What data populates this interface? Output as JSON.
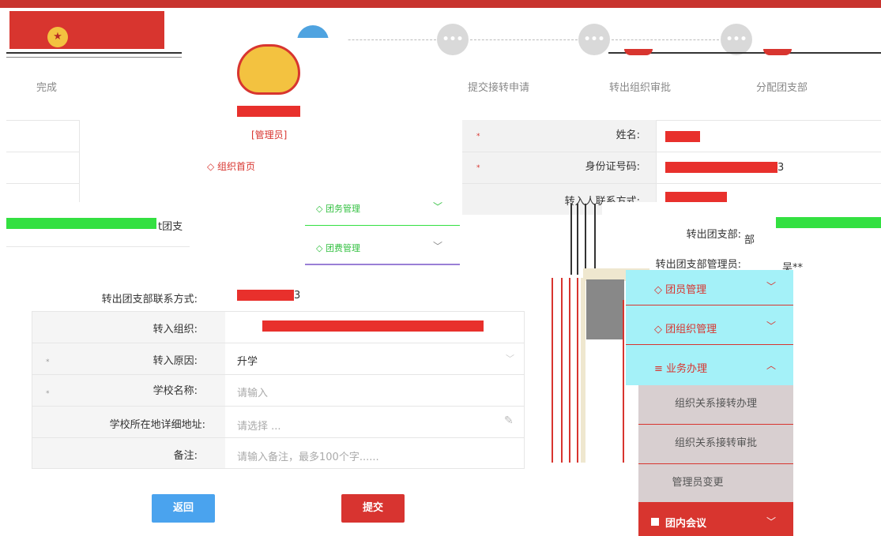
{
  "header": {
    "logo_glyph": "★"
  },
  "steps": [
    {
      "label": "完成",
      "icon": "more-dots-icon"
    },
    {
      "label": "",
      "icon": "more-dots-icon"
    },
    {
      "label": "提交接转申请",
      "icon": "more-dots-icon"
    },
    {
      "label": "转出组织审批",
      "icon": "more-dots-icon"
    },
    {
      "label": "分配团支部",
      "icon": "more-dots-icon"
    }
  ],
  "dots": "•••",
  "required_mark": "*",
  "personal": {
    "name_label": "姓名:",
    "id_label": "身份证号码:",
    "id_suffix": "3",
    "contact_label": "转入人联系方式:",
    "out_branch_label": "转出团支部:",
    "out_branch_value": "部",
    "out_admin_label": "转出团支部管理员:",
    "out_admin_value": "吴**",
    "left_branch_fragment": "t团支"
  },
  "form": {
    "out_contact_label": "转出团支部联系方式:",
    "out_contact_suffix": "3",
    "in_org_label": "转入组织:",
    "reason_label": "转入原因:",
    "reason_value": "升学",
    "school_label": "学校名称:",
    "school_placeholder": "请输入",
    "address_label": "学校所在地详细地址:",
    "address_placeholder": "请选择 ...",
    "remark_label": "备注:",
    "remark_placeholder": "请输入备注，最多100个字......"
  },
  "buttons": {
    "back": "返回",
    "submit": "提交"
  },
  "popup_menu": {
    "user_label": "[管理员]",
    "home_label": "◇ 组织首页",
    "item1": "◇ 团务管理",
    "item2": "◇ 团费管理"
  },
  "side_menu": {
    "item1": "◇ 团员管理",
    "item2": "◇ 团组织管理",
    "business": "≡ 业务办理",
    "sub1": "组织关系接转办理",
    "sub2": "组织关系接转审批",
    "sub3": "管理员变更",
    "meeting": "团内会议"
  },
  "colors": {
    "brand_red": "#d8352f",
    "step_blue": "#4fa3e0",
    "back_blue": "#4aa3ee",
    "submit_red": "#d83430"
  }
}
